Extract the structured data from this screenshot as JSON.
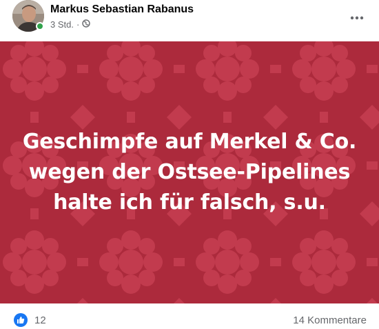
{
  "post": {
    "author": "Markus Sebastian Rabanus",
    "timestamp": "3 Std.",
    "separator": "·",
    "privacy_icon": "globe-icon",
    "more_icon": "more-options-icon"
  },
  "banner": {
    "background_color": "#ac2a3c",
    "pattern_color": "#c23b4e",
    "lines": [
      "Geschimpfe auf Merkel & Co.",
      "wegen der Ostsee-Pipelines",
      "halte ich für falsch, s.u."
    ]
  },
  "reactions": {
    "icon": "thumbs-up-icon",
    "count": "12",
    "comments": "14 Kommentare"
  },
  "colors": {
    "like_blue": "#1877f2",
    "online_green": "#31a24c",
    "secondary_text": "#65676b"
  }
}
